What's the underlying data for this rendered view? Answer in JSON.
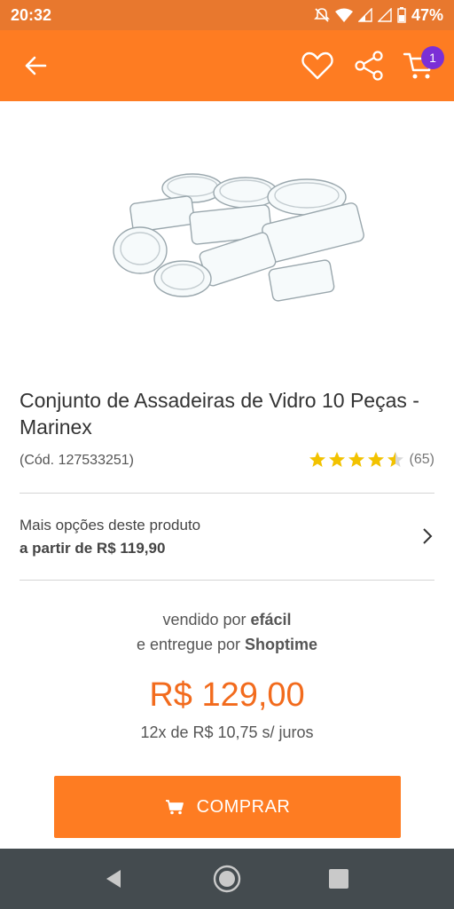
{
  "status_bar": {
    "time": "20:32",
    "battery": "47%"
  },
  "app_bar": {
    "cart_count": "1"
  },
  "product": {
    "title": "Conjunto de Assadeiras de Vidro 10 Peças - Marinex",
    "code": "(Cód. 127533251)",
    "rating_stars": 4.5,
    "rating_count": "(65)"
  },
  "options": {
    "label": "Mais opções deste produto",
    "price": "a partir de R$ 119,90"
  },
  "seller": {
    "sold_prefix": "vendido por",
    "sold_by": "efácil",
    "delivered_prefix": "e entregue por",
    "delivered_by": "Shoptime"
  },
  "pricing": {
    "price": "R$ 129,00",
    "installments": "12x de R$ 10,75 s/ juros"
  },
  "buy_button": {
    "label": "COMPRAR"
  },
  "colors": {
    "brand_orange": "#fe7c22",
    "price_orange": "#f26b1d",
    "badge_purple": "#7b2fd6",
    "star_yellow": "#f2c200"
  }
}
